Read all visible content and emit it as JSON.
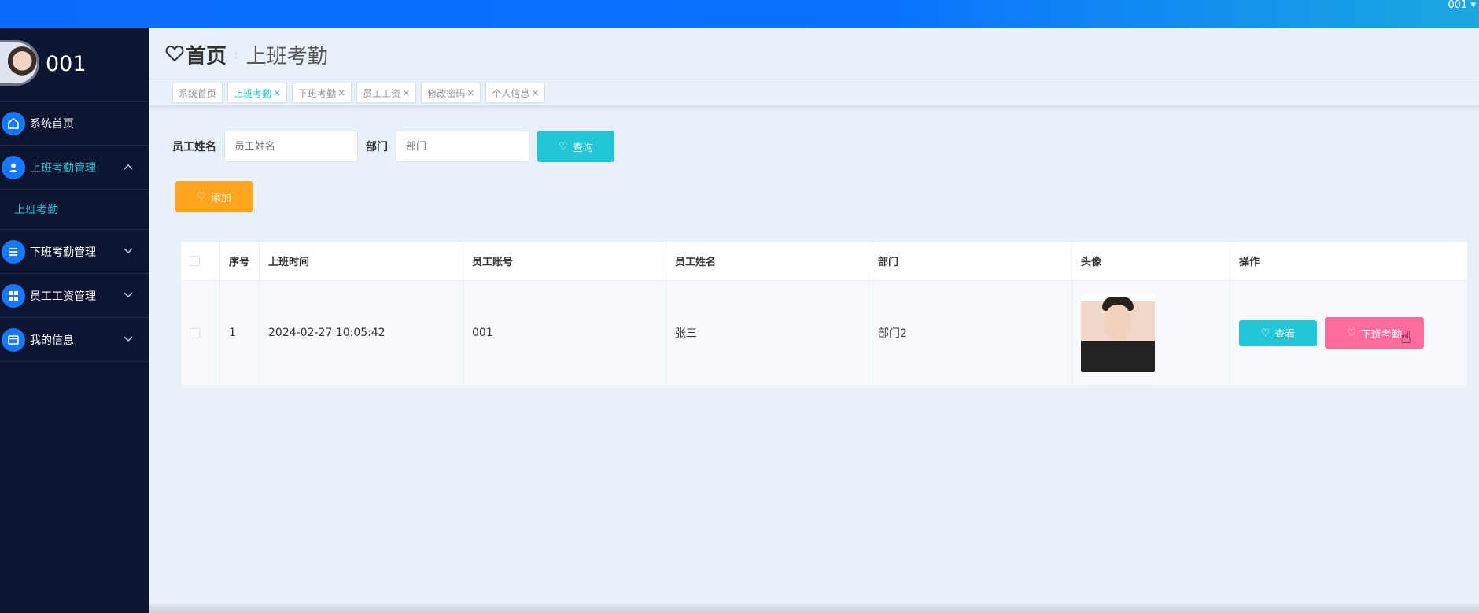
{
  "topbar": {
    "user": "001 ▾"
  },
  "sidebar": {
    "profile_name": "001",
    "items": [
      {
        "label": "系统首页",
        "icon": "home-icon"
      },
      {
        "label": "上班考勤管理",
        "icon": "user-icon",
        "expanded": true
      },
      {
        "label": "上班考勤",
        "submenu": true
      },
      {
        "label": "下班考勤管理",
        "icon": "list-icon"
      },
      {
        "label": "员工工资管理",
        "icon": "grid-icon"
      },
      {
        "label": "我的信息",
        "icon": "card-icon"
      }
    ]
  },
  "breadcrumb": {
    "home": "首页",
    "separator": ":",
    "current": "上班考勤"
  },
  "tabs": [
    {
      "label": "系统首页",
      "closable": false
    },
    {
      "label": "上班考勤",
      "closable": true,
      "active": true
    },
    {
      "label": "下班考勤",
      "closable": true
    },
    {
      "label": "员工工资",
      "closable": true
    },
    {
      "label": "修改密码",
      "closable": true
    },
    {
      "label": "个人信息",
      "closable": true
    }
  ],
  "search": {
    "name_label": "员工姓名",
    "name_placeholder": "员工姓名",
    "dept_label": "部门",
    "dept_placeholder": "部门",
    "query_label": "查询"
  },
  "add_label": "添加",
  "table": {
    "headers": [
      "序号",
      "上班时间",
      "员工账号",
      "员工姓名",
      "部门",
      "头像",
      "操作"
    ],
    "rows": [
      {
        "index": "1",
        "time": "2024-02-27 10:05:42",
        "account": "001",
        "name": "张三",
        "dept": "部门2"
      }
    ],
    "actions": {
      "view": "查看",
      "off_duty": "下班考勤"
    }
  },
  "colors": {
    "accent": "#22c6d6",
    "primary": "#1677ff",
    "warning": "#ffa41c",
    "pink": "#ff6b9a",
    "sidebar_bg": "#0d1530"
  }
}
